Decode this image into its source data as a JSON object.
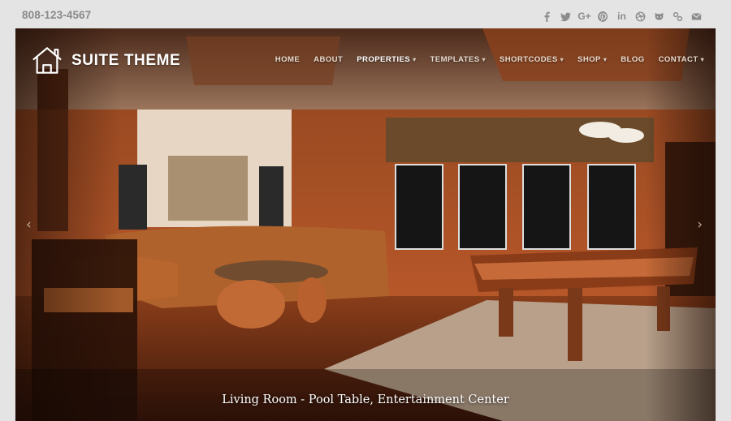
{
  "topbar": {
    "phone": "808-123-4567",
    "social_icons": [
      "facebook-icon",
      "twitter-icon",
      "google-plus-icon",
      "pinterest-icon",
      "linkedin-icon",
      "dribbble-icon",
      "github-icon",
      "flickr-icon",
      "email-icon"
    ]
  },
  "header": {
    "logo_text": "SUITE THEME",
    "nav": [
      {
        "label": "HOME",
        "dropdown": false,
        "active": false
      },
      {
        "label": "ABOUT",
        "dropdown": false,
        "active": false
      },
      {
        "label": "PROPERTIES",
        "dropdown": true,
        "active": true
      },
      {
        "label": "TEMPLATES",
        "dropdown": true,
        "active": false
      },
      {
        "label": "SHORTCODES",
        "dropdown": true,
        "active": false
      },
      {
        "label": "SHOP",
        "dropdown": true,
        "active": false
      },
      {
        "label": "BLOG",
        "dropdown": false,
        "active": false
      },
      {
        "label": "CONTACT",
        "dropdown": true,
        "active": false
      }
    ]
  },
  "slider": {
    "caption": "Living Room - Pool Table, Entertainment Center",
    "prev_glyph": "‹",
    "next_glyph": "›"
  },
  "colors": {
    "page_bg": "#e4e4e4",
    "muted_text": "#8a8a8a"
  }
}
